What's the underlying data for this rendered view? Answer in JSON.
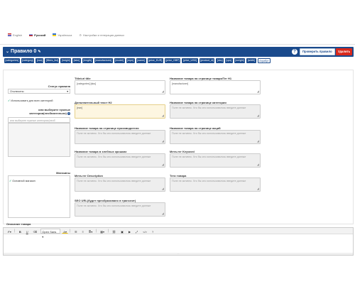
{
  "lang_tabs": [
    {
      "label": "English",
      "flag": "flag-en",
      "active": false
    },
    {
      "label": "Русский",
      "flag": "flag-ru",
      "active": true
    },
    {
      "label": "Українська",
      "flag": "flag-ua",
      "active": false
    },
    {
      "label": "Настройки и генерация данных",
      "flag": "gear",
      "active": false
    }
  ],
  "header": {
    "title": "Правило 0",
    "check_button": "Проверить правило",
    "delete_button": "Удалить"
  },
  "chips": [
    "[categories]",
    "[category]",
    "[ean]",
    "[filters_list]",
    "[height]",
    "[isbn]",
    "[length]",
    "[manufacturer]",
    "[model]",
    "[mpn]",
    "[name]",
    "[price_EUR]",
    "[price_GBP]",
    "[price_USD]",
    "[product_id]",
    "[sku]",
    "[upc]",
    "[weight]",
    "[width]",
    "Атрибут"
  ],
  "left": {
    "status_label": "Статус правила",
    "status_value": "Отключено",
    "all_categories_label": "Использовать для всех категорий",
    "or_choose_label_1": "или выберите нужные",
    "or_choose_label_2": "категории(необязательно)",
    "category_placeholder": "или выберите нужные категории(необ",
    "stores_label": "Магазины",
    "default_store_label": "Основной магазин"
  },
  "fields_left": [
    {
      "label": "Title/url title",
      "value": "[categories] [sku]",
      "style": "normal"
    },
    {
      "label": "Дополнительный текст H2",
      "value": "[ean]",
      "style": "yellow"
    },
    {
      "label": "Название товара на странице производителя",
      "value": "Поле не активно. Что бы оно использовалось введите данные",
      "style": "gray"
    },
    {
      "label": "Название товара в хлебных крошках",
      "value": "Поле не активно. Что бы оно использовалось введите данные",
      "style": "gray"
    },
    {
      "label": "Мета-тег Description",
      "value": "Поле не активно. Что бы оно использовалось введите данные",
      "style": "gray"
    },
    {
      "label": "SEO URL(будет преобразовано в транслит)",
      "value": "Поле не активно. Что бы оно использовалось введите данные",
      "style": "gray"
    }
  ],
  "fields_right": [
    {
      "label": "Название товара на странице товара/Тег H1",
      "value": "[manufacturer]",
      "style": "normal"
    },
    {
      "label": "Название товара на странице категории",
      "value": "Поле не активно. Что бы оно использовалось введите данные",
      "style": "gray"
    },
    {
      "label": "Название товара на странице акций",
      "value": "Поле не активно. Что бы оно использовалось введите данные",
      "style": "gray"
    },
    {
      "label": "Мета-тег Keyword",
      "value": "Поле не активно. Что бы оно использовалось введите данные",
      "style": "gray"
    },
    {
      "label": "Теги товара",
      "value": "Поле не активно. Что бы оно использовалось введите данные",
      "style": "gray"
    }
  ],
  "editor": {
    "label": "Описание товара",
    "font_select": "Open Sans",
    "grip": "…"
  },
  "colors": {
    "header": "#1a4a8c",
    "delete": "#d9291c",
    "highlight": "#fdf6e1"
  }
}
